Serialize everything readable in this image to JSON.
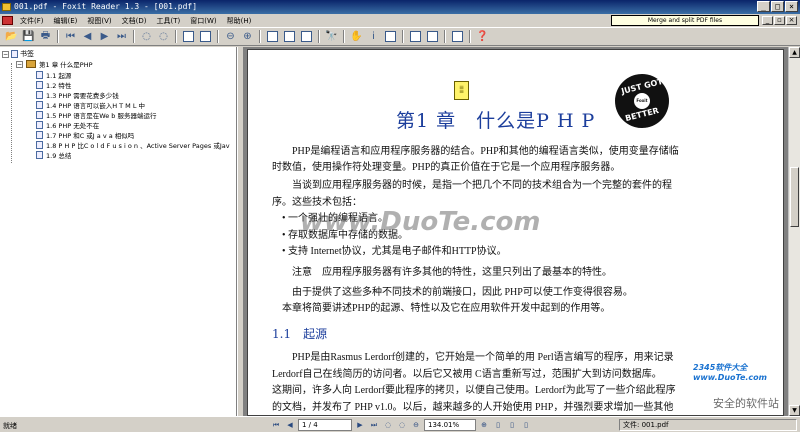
{
  "window": {
    "title": "001.pdf - Foxit Reader 1.3 - [001.pdf]"
  },
  "menu": [
    "文件(F)",
    "编辑(E)",
    "视图(V)",
    "文档(D)",
    "工具(T)",
    "窗口(W)",
    "帮助(H)"
  ],
  "tooltip": "Merge and split PDF files",
  "bookmarks": {
    "root": "书签",
    "chapter": "第1 章 什么是PHP",
    "items": [
      "1.1 起源",
      "1.2 特性",
      "1.3 PHP 需要花费多少钱",
      "1.4 PHP 语言可以嵌入H T M L 中",
      "1.5 PHP 语言是在We b 服务器端运行",
      "1.6 PHP 无处不在",
      "1.7 PHP 和C 或J a v a 相似吗",
      "1.8 P H P 比C o l d F u s i o n 、Active Server Pages 或Jav",
      "1.9 总结"
    ]
  },
  "doc": {
    "chapter_title": "第1 章　什么是P H P",
    "badge_top": "JUST GOT",
    "badge_bottom": "BETTER",
    "badge_center": "Foxit",
    "lines": [
      "PHP是编程语言和应用程序服务器的结合。PHP和其他的编程语言类似，使用变量存储临",
      "时数值，使用操作符处理变量。PHP的真正价值在于它是一个应用程序服务器。",
      "当谈到应用程序服务器的时候，是指一个把几个不同的技术组合为一个完整的套件的程",
      "序。这些技术包括：",
      "• 一个强壮的编程语言。",
      "• 存取数据库中存储的数据。",
      "• 支持 Internet协议，尤其是电子邮件和HTTP协议。",
      "注意　应用程序服务器有许多其他的特性，这里只列出了最基本的特性。",
      "由于提供了这些多种不同技术的前端接口，因此 PHP可以使工作变得很容易。",
      "本章将简要讲述PHP的起源、特性以及它在应用软件开发中起到的作用等。",
      "PHP是由Rasmus Lerdorf创建的，它开始是一个简单的用 Perl语言编写的程序，用来记录",
      "Lerdorf自己在线简历的访问者。以后它又被用 C语言重新写过，范围扩大到访问数据库。",
      "这期间，许多人向 Lerdorf要此程序的拷贝，以便自己使用。Lerdorf为此写了一些介绍此程序",
      "的文档，并发布了 PHP v1.0。以后，越来越多的人开始使用 PHP，并强烈要求增加一些其他"
    ],
    "section_title": "1.1　起源",
    "watermark_main": "www.DuoTe.com",
    "watermark_corner": "www.DuoTe.com",
    "watermark_brand": "2345软件大全",
    "watermark_safe": "安全的软件站"
  },
  "status": {
    "left": "就绪",
    "page": "1 / 4",
    "zoom": "134.01%",
    "file_label": "文件: 001.pdf"
  }
}
